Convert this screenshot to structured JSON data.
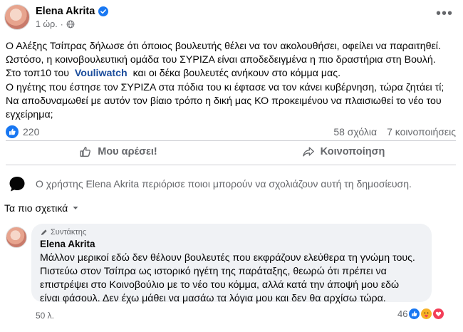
{
  "post": {
    "author": "Elena Akrita",
    "time": "1 ώρ.",
    "dot": "·",
    "lines": [
      "Ο Αλέξης Τσίπρας δήλωσε ότι όποιος βουλευτής θέλει να τον ακολουθήσει, οφείλει να παραιτηθεί.",
      "Ωστόσο, η κοινοβουλευτική ομάδα του ΣΥΡΙΖΑ είναι αποδεδειγμένα η πιο δραστήρια στη Βουλή.",
      "Στο τοπ10 του",
      "Vouliwatch",
      "και οι δέκα βουλευτές ανήκουν στο κόμμα μας.",
      "Ο ηγέτης που έστησε τον ΣΥΡΙΖΑ στα πόδια του κι έφτασε να τον κάνει κυβέρνηση, τώρα ζητάει τί;",
      "Να αποδυναμωθεί με αυτόν τον βίαιο τρόπο η δική μας ΚΟ προκειμένου να πλαισιωθεί το νέο του",
      "εγχείρημα;"
    ],
    "reactions_count": "220",
    "comments_count": "58 σχόλια",
    "shares_count": "7 κοινοποιήσεις"
  },
  "actions": {
    "like": "Μου αρέσει!",
    "share": "Κοινοποίηση"
  },
  "restricted_notice": "Ο χρήστης Elena Akrita περιόρισε ποιοι μπορούν να σχολιάζουν αυτή τη δημοσίευση.",
  "sort_label": "Τα πιο σχετικά",
  "comment": {
    "author_tag": "Συντάκτης",
    "author": "Elena Akrita",
    "lines": [
      "Μάλλον μερικοί εδώ δεν θέλουν βουλευτές που εκφράζουν ελεύθερα τη γνώμη τους.",
      "Πιστεύω στον Τσίπρα ως ιστορικό ηγέτη της παράταξης, θεωρώ ότι πρέπει να",
      "επιστρέψει στο Κοινοβούλιο με το νέο του κόμμα, αλλά κατά την άποψή μου εδώ",
      "είναι φάσουλ. Δεν έχω μάθει να μασάω τα λόγια μου και δεν θα αρχίσω τώρα."
    ],
    "time": "50 λ.",
    "reactions_count": "46"
  },
  "colors": {
    "facebook_blue": "#1877f2",
    "link": "#1b4d9c",
    "secondary_text": "#65676b",
    "bubble_bg": "#f0f2f5",
    "love_red": "#f33e58"
  },
  "icons": [
    "verified-icon",
    "globe-icon",
    "more-options-icon",
    "like-badge-icon",
    "like-thumb-icon",
    "share-arrow-icon",
    "comment-bubble-icon",
    "chevron-down-icon",
    "author-tag-icon",
    "love-heart-icon",
    "care-icon"
  ]
}
